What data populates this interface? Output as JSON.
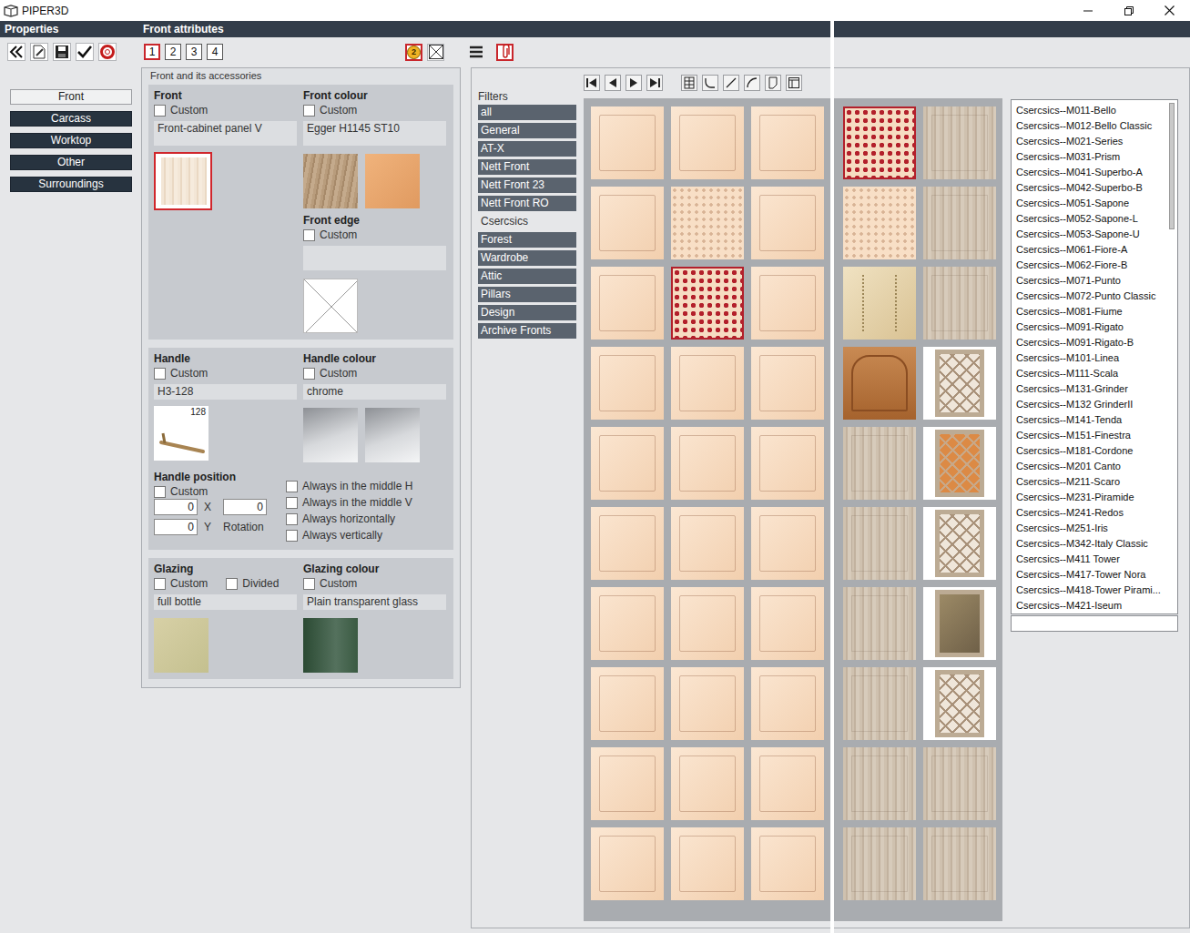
{
  "window": {
    "title": "PIPER3D"
  },
  "header": {
    "left": "Properties",
    "right": "Front attributes"
  },
  "pages": [
    {
      "label": "1",
      "selected": true
    },
    {
      "label": "2",
      "selected": false
    },
    {
      "label": "3",
      "selected": false
    },
    {
      "label": "4",
      "selected": false
    }
  ],
  "coin": {
    "label": "2",
    "selected": true
  },
  "clip": {
    "selected": true
  },
  "sidebar": [
    {
      "label": "Front",
      "selected": true
    },
    {
      "label": "Carcass",
      "selected": false
    },
    {
      "label": "Worktop",
      "selected": false
    },
    {
      "label": "Other",
      "selected": false
    },
    {
      "label": "Surroundings",
      "selected": false
    }
  ],
  "panel": {
    "title": "Front and its accessories",
    "front": {
      "title": "Front",
      "custom": {
        "label": "Custom",
        "checked": false
      },
      "value": "Front-cabinet panel V",
      "selected": true
    },
    "front_colour": {
      "title": "Front colour",
      "custom": {
        "label": "Custom",
        "checked": false
      },
      "value": "Egger H1145 ST10"
    },
    "front_edge": {
      "title": "Front edge",
      "custom": {
        "label": "Custom",
        "checked": false
      },
      "value": ""
    },
    "handle": {
      "title": "Handle",
      "custom": {
        "label": "Custom",
        "checked": false
      },
      "value": "H3-128",
      "size": "128"
    },
    "handle_colour": {
      "title": "Handle colour",
      "custom": {
        "label": "Custom",
        "checked": false
      },
      "value": "chrome"
    },
    "handle_position": {
      "title": "Handle position",
      "custom": {
        "label": "Custom",
        "checked": false
      },
      "x": {
        "label": "X",
        "value": "0"
      },
      "y": {
        "label": "Y",
        "value": "0"
      },
      "rotation": {
        "label": "Rotation",
        "value": "0"
      },
      "options": [
        {
          "label": "Always in the middle H",
          "checked": false
        },
        {
          "label": "Always in the middle V",
          "checked": false
        },
        {
          "label": "Always horizontally",
          "checked": false
        },
        {
          "label": "Always vertically",
          "checked": false
        }
      ]
    },
    "glazing": {
      "title": "Glazing",
      "custom": {
        "label": "Custom",
        "checked": false
      },
      "divided": {
        "label": "Divided",
        "checked": false
      },
      "value": "full bottle"
    },
    "glazing_colour": {
      "title": "Glazing colour",
      "custom": {
        "label": "Custom",
        "checked": false
      },
      "value": "Plain transparent glass"
    }
  },
  "filters": {
    "title": "Filters",
    "items": [
      {
        "label": "all",
        "selected": false
      },
      {
        "label": "General",
        "selected": false
      },
      {
        "label": "AT-X",
        "selected": false
      },
      {
        "label": "Nett Front",
        "selected": false
      },
      {
        "label": "Nett Front 23",
        "selected": false
      },
      {
        "label": "Nett Front RO",
        "selected": false
      },
      {
        "label": "Csercsics",
        "selected": true
      },
      {
        "label": "Forest",
        "selected": false
      },
      {
        "label": "Wardrobe",
        "selected": false
      },
      {
        "label": "Attic",
        "selected": false
      },
      {
        "label": "Pillars",
        "selected": false
      },
      {
        "label": "Design",
        "selected": false
      },
      {
        "label": "Archive Fronts",
        "selected": false
      }
    ]
  },
  "gallery": {
    "tiles": [
      {
        "kind": "peach"
      },
      {
        "kind": "peach"
      },
      {
        "kind": "peach"
      },
      {
        "kind": "dots"
      },
      {
        "kind": "wood"
      },
      {
        "kind": "peach"
      },
      {
        "kind": "pattern"
      },
      {
        "kind": "peach"
      },
      {
        "kind": "pattern"
      },
      {
        "kind": "wood"
      },
      {
        "kind": "peach"
      },
      {
        "kind": "dots"
      },
      {
        "kind": "peach"
      },
      {
        "kind": "gold"
      },
      {
        "kind": "wood"
      },
      {
        "kind": "peach"
      },
      {
        "kind": "peach"
      },
      {
        "kind": "peach"
      },
      {
        "kind": "brown"
      },
      {
        "kind": "lattice"
      },
      {
        "kind": "peach"
      },
      {
        "kind": "peach"
      },
      {
        "kind": "peach"
      },
      {
        "kind": "wood"
      },
      {
        "kind": "amber"
      },
      {
        "kind": "peach"
      },
      {
        "kind": "peach"
      },
      {
        "kind": "peach"
      },
      {
        "kind": "wood"
      },
      {
        "kind": "lattice"
      },
      {
        "kind": "peach"
      },
      {
        "kind": "peach"
      },
      {
        "kind": "peach"
      },
      {
        "kind": "wood"
      },
      {
        "kind": "glass"
      },
      {
        "kind": "peach"
      },
      {
        "kind": "peach"
      },
      {
        "kind": "peach"
      },
      {
        "kind": "wood"
      },
      {
        "kind": "lattice"
      },
      {
        "kind": "peach"
      },
      {
        "kind": "peach"
      },
      {
        "kind": "peach"
      },
      {
        "kind": "wood"
      },
      {
        "kind": "wood"
      },
      {
        "kind": "peach"
      },
      {
        "kind": "peach"
      },
      {
        "kind": "peach"
      },
      {
        "kind": "wood"
      },
      {
        "kind": "wood"
      }
    ]
  },
  "catalog": {
    "items": [
      {
        "label": "Csercsics--M011-Bello",
        "selected": false
      },
      {
        "label": "Csercsics--M012-Bello Classic",
        "selected": false
      },
      {
        "label": "Csercsics--M021-Series",
        "selected": false
      },
      {
        "label": "Csercsics--M031-Prism",
        "selected": false
      },
      {
        "label": "Csercsics--M041-Superbo-A",
        "selected": false
      },
      {
        "label": "Csercsics--M042-Superbo-B",
        "selected": false
      },
      {
        "label": "Csercsics--M051-Sapone",
        "selected": false
      },
      {
        "label": "Csercsics--M052-Sapone-L",
        "selected": false
      },
      {
        "label": "Csercsics--M053-Sapone-U",
        "selected": false
      },
      {
        "label": "Csercsics--M061-Fiore-A",
        "selected": false
      },
      {
        "label": "Csercsics--M062-Fiore-B",
        "selected": false
      },
      {
        "label": "Csercsics--M071-Punto",
        "selected": false
      },
      {
        "label": "Csercsics--M072-Punto Classic",
        "selected": false
      },
      {
        "label": "Csercsics--M081-Fiume",
        "selected": false
      },
      {
        "label": "Csercsics--M091-Rigato",
        "selected": false
      },
      {
        "label": "Csercsics--M091-Rigato-B",
        "selected": false
      },
      {
        "label": "Csercsics--M101-Linea",
        "selected": false
      },
      {
        "label": "Csercsics--M111-Scala",
        "selected": false
      },
      {
        "label": "Csercsics--M131-Grinder",
        "selected": false
      },
      {
        "label": "Csercsics--M132 GrinderII",
        "selected": false
      },
      {
        "label": "Csercsics--M141-Tenda",
        "selected": false
      },
      {
        "label": "Csercsics--M151-Finestra",
        "selected": false
      },
      {
        "label": "Csercsics--M181-Cordone",
        "selected": false
      },
      {
        "label": "Csercsics--M201 Canto",
        "selected": false
      },
      {
        "label": "Csercsics--M211-Scaro",
        "selected": false
      },
      {
        "label": "Csercsics--M231-Piramide",
        "selected": false
      },
      {
        "label": "Csercsics--M241-Redos",
        "selected": false
      },
      {
        "label": "Csercsics--M251-Iris",
        "selected": false
      },
      {
        "label": "Csercsics--M342-Italy Classic",
        "selected": false
      },
      {
        "label": "Csercsics--M411 Tower",
        "selected": false
      },
      {
        "label": "Csercsics--M417-Tower Nora",
        "selected": false
      },
      {
        "label": "Csercsics--M418-Tower Pirami...",
        "selected": false
      },
      {
        "label": "Csercsics--M421-Iseum",
        "selected": false
      }
    ],
    "scrollbar": {
      "level": 0.25
    },
    "search": ""
  }
}
